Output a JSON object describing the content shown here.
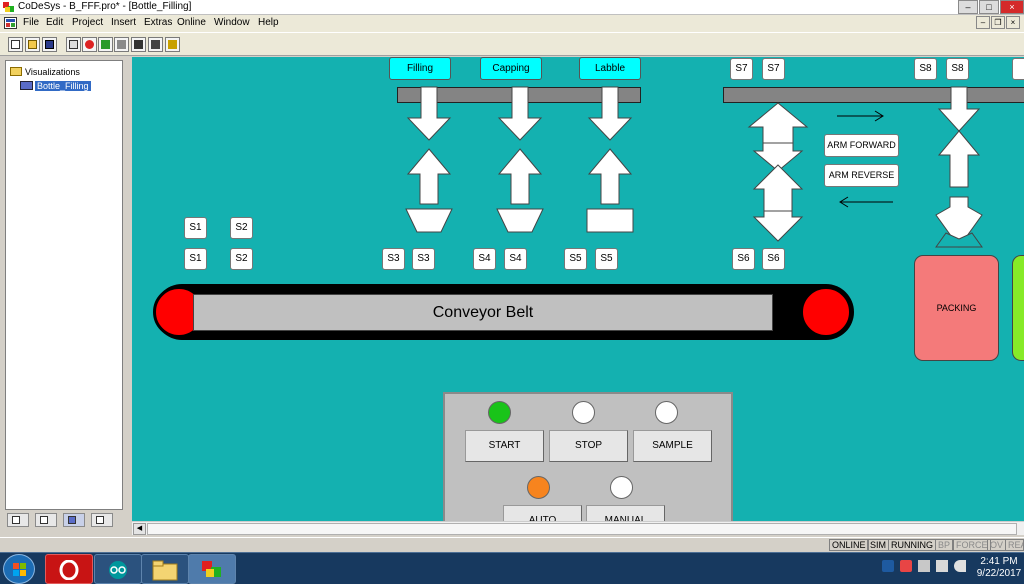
{
  "window": {
    "title": "CoDeSys - B_FFF.pro* - [Bottle_Filling]"
  },
  "menu": [
    "File",
    "Edit",
    "Project",
    "Insert",
    "Extras",
    "Online",
    "Window",
    "Help"
  ],
  "tree": {
    "root": "Visualizations",
    "child": "Bottle_Filling"
  },
  "stations": {
    "filling": "Filling",
    "capping": "Capping",
    "labelling": "Labble"
  },
  "sensors": {
    "s1": "S1",
    "s2": "S2",
    "s3": "S3",
    "s4": "S4",
    "s5": "S5",
    "s6": "S6",
    "s7": "S7",
    "s8": "S8"
  },
  "arm": {
    "forward": "ARM FORWARD",
    "reverse": "ARM REVERSE"
  },
  "conveyor": {
    "label": "Conveyor Belt"
  },
  "packing": {
    "label": "PACKING"
  },
  "controls": {
    "start": "START",
    "stop": "STOP",
    "sample": "SAMPLE",
    "auto": "AUTO",
    "manual": "MANUAL"
  },
  "lamps": {
    "start": "#19c419",
    "stop": "#ffffff",
    "sample": "#ffffff",
    "auto": "#f7841e",
    "manual": "#ffffff"
  },
  "status": {
    "online": "ONLINE",
    "sim": "SIM",
    "running": "RUNNING",
    "bp": "BP",
    "force": "FORCE",
    "ov": "OV",
    "read": "READ"
  },
  "clock": {
    "time": "2:41 PM",
    "date": "9/22/2017"
  },
  "colors": {
    "canvas": "#14b1b0",
    "station_label": "#00ffff",
    "roller": "#ff0000",
    "packing": "#f47a7a"
  }
}
